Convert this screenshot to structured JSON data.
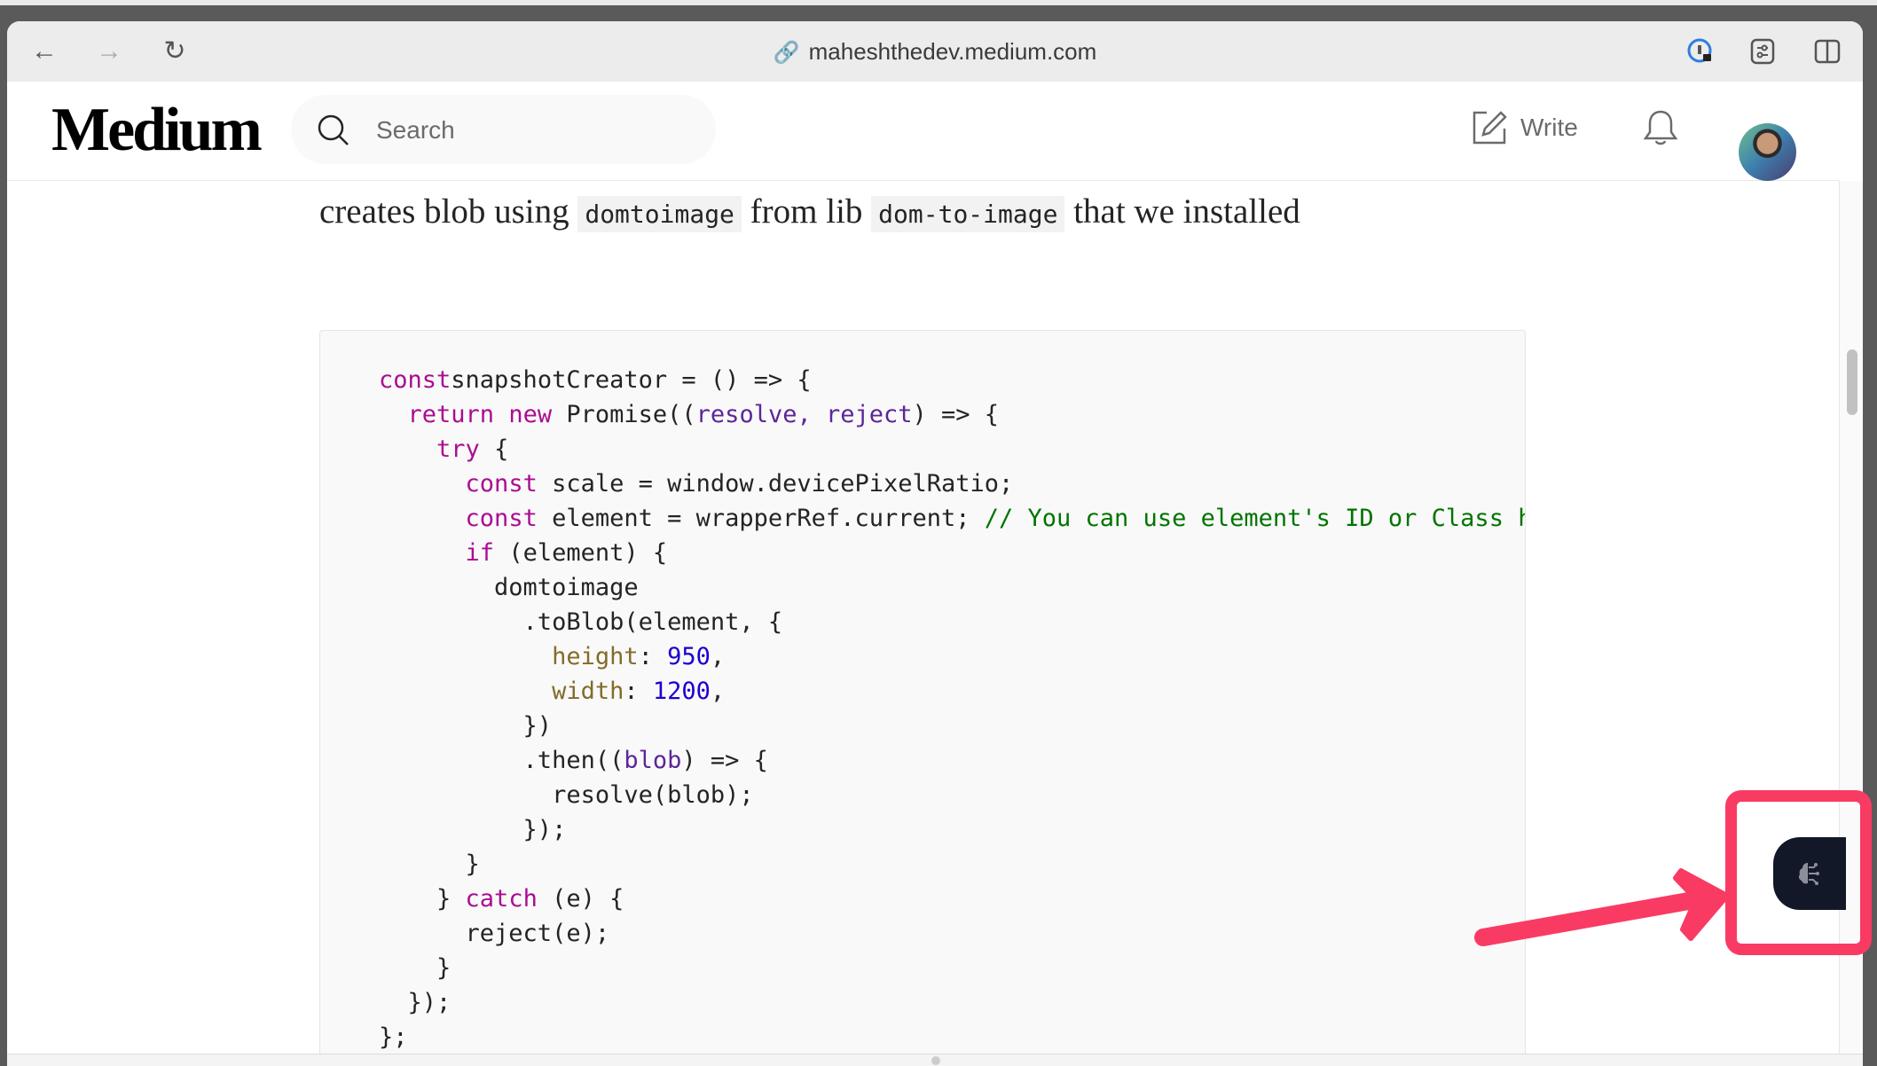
{
  "browser": {
    "url": "maheshthedev.medium.com",
    "icons": [
      "back-icon",
      "forward-icon",
      "reload-icon",
      "link-icon",
      "password-manager-icon",
      "extensions-icon",
      "sidebar-icon"
    ]
  },
  "header": {
    "logo": "Medium",
    "search_placeholder": "Search",
    "write_label": "Write"
  },
  "article": {
    "para_prefix": "creates blob using ",
    "code1": "domtoimage",
    "para_middle": " from lib ",
    "code2": "dom-to-image",
    "para_suffix": " that we installed",
    "code_lines": [
      [
        [
          "kw",
          "const"
        ],
        [
          "",
          "snapshotCreator = () => {"
        ]
      ],
      [
        [
          "",
          "  "
        ],
        [
          "kw",
          "return"
        ],
        [
          "",
          " "
        ],
        [
          "kw",
          "new"
        ],
        [
          "",
          " Promise(("
        ],
        [
          "pa",
          "resolve, reject"
        ],
        [
          "",
          ") => {"
        ]
      ],
      [
        [
          "",
          "    "
        ],
        [
          "kw",
          "try"
        ],
        [
          "",
          " {"
        ]
      ],
      [
        [
          "",
          "      "
        ],
        [
          "kw",
          "const"
        ],
        [
          "",
          " scale = window.devicePixelRatio;"
        ]
      ],
      [
        [
          "",
          "      "
        ],
        [
          "kw",
          "const"
        ],
        [
          "",
          " element = wrapperRef.current; "
        ],
        [
          "cm",
          "// You can use element's ID or Class here"
        ]
      ],
      [
        [
          "",
          "      "
        ],
        [
          "kw",
          "if"
        ],
        [
          "",
          " (element) {"
        ]
      ],
      [
        [
          "",
          "        domtoimage"
        ]
      ],
      [
        [
          "",
          "          .toBlob(element, {"
        ]
      ],
      [
        [
          "",
          "            "
        ],
        [
          "pr",
          "height"
        ],
        [
          "",
          ": "
        ],
        [
          "nu",
          "950"
        ],
        [
          "",
          ","
        ]
      ],
      [
        [
          "",
          "            "
        ],
        [
          "pr",
          "width"
        ],
        [
          "",
          ": "
        ],
        [
          "nu",
          "1200"
        ],
        [
          "",
          ","
        ]
      ],
      [
        [
          "",
          "          })"
        ]
      ],
      [
        [
          "",
          "          .then(("
        ],
        [
          "pa",
          "blob"
        ],
        [
          "",
          ") => {"
        ]
      ],
      [
        [
          "",
          "            resolve(blob);"
        ]
      ],
      [
        [
          "",
          "          });"
        ]
      ],
      [
        [
          "",
          "      }"
        ]
      ],
      [
        [
          "",
          "    } "
        ],
        [
          "kw",
          "catch"
        ],
        [
          "",
          " (e) {"
        ]
      ],
      [
        [
          "",
          "      reject(e);"
        ]
      ],
      [
        [
          "",
          "    }"
        ]
      ],
      [
        [
          "",
          "  });"
        ]
      ],
      [
        [
          "",
          "};"
        ]
      ]
    ]
  },
  "annotation": {
    "color": "#f93b63",
    "widget_icon": "brain-circuit-icon",
    "widget_bg": "#121828"
  }
}
